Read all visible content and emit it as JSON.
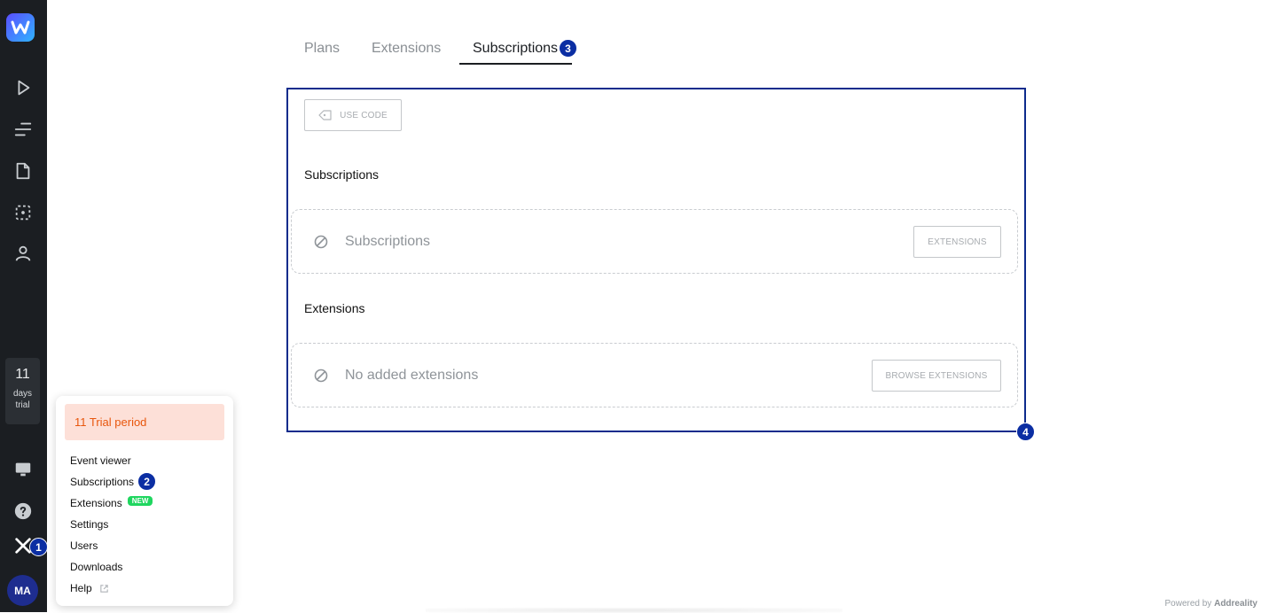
{
  "sidebar": {
    "trial_days": "11",
    "trial_label_line1": "days",
    "trial_label_line2": "trial",
    "avatar_initials": "MA",
    "tools_badge": "1",
    "icons": [
      "logo-icon",
      "play-icon",
      "playlist-icon",
      "file-icon",
      "dashed-square-icon",
      "user-icon",
      "monitor-icon",
      "help-icon",
      "tools-icon"
    ]
  },
  "popup": {
    "trial_text": "11 Trial period",
    "items": [
      {
        "label": "Event viewer"
      },
      {
        "label": "Subscriptions",
        "badge": "2"
      },
      {
        "label": "Extensions",
        "tag": "NEW"
      },
      {
        "label": "Settings"
      },
      {
        "label": "Users"
      },
      {
        "label": "Downloads"
      },
      {
        "label": "Help",
        "icon": "external-link-icon"
      }
    ]
  },
  "tabs": [
    {
      "label": "Plans"
    },
    {
      "label": "Extensions"
    },
    {
      "label": "Subscriptions",
      "active": true,
      "badge": "3"
    }
  ],
  "main": {
    "use_code_label": "USE CODE",
    "frame_badge": "4",
    "subscriptions": {
      "title": "Subscriptions",
      "empty_text": "Subscriptions",
      "button_label": "EXTENSIONS"
    },
    "extensions": {
      "title": "Extensions",
      "empty_text": "No added extensions",
      "button_label": "BROWSE EXTENSIONS"
    }
  },
  "footer": {
    "powered_prefix": "Powered by",
    "powered_brand": "Addreality"
  },
  "colors": {
    "sidebar_bg": "#1b1e22",
    "accent_badge": "#0b2ea3",
    "trial_orange": "#e8560c",
    "trial_bg": "#fde0d8",
    "new_tag": "#1fd65f",
    "frame_border": "#0d2b8c"
  }
}
